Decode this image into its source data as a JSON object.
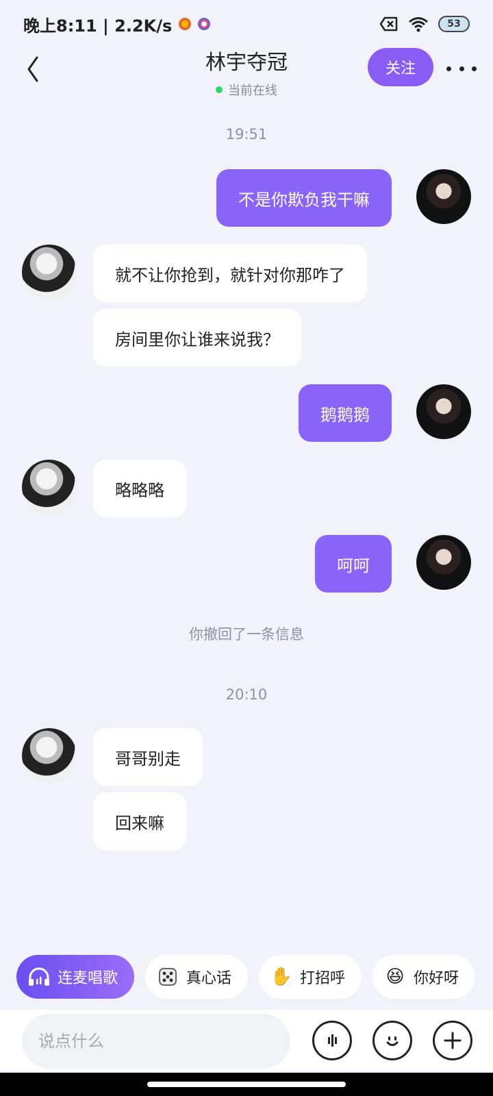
{
  "status_bar": {
    "time_speed": "晚上8:11 | 2.2K/s",
    "battery": "53"
  },
  "header": {
    "title": "林宇夺冠",
    "online_status": "当前在线",
    "follow_label": "关注"
  },
  "chat": {
    "time1": "19:51",
    "msg1": "不是你欺负我干嘛",
    "msg2": "就不让你抢到，就针对你那咋了",
    "msg3": "房间里你让谁来说我？",
    "msg4": "鹅鹅鹅",
    "msg5": "略略略",
    "msg6": "呵呵",
    "recall_notice": "你撤回了一条信息",
    "time2": "20:10",
    "msg7": "哥哥别走",
    "msg8": "回来嘛"
  },
  "quick_replies": [
    {
      "label": "连麦唱歌",
      "icon": "headphone-icon"
    },
    {
      "label": "真心话",
      "icon": "dice-icon"
    },
    {
      "label": "打招呼",
      "icon": "wave-hand-icon"
    },
    {
      "label": "你好呀",
      "icon": "laughing-face-icon"
    }
  ],
  "input": {
    "placeholder": "说点什么"
  },
  "colors": {
    "accent": "#8a64f8",
    "background": "#f2f3fa",
    "online": "#2fd46a"
  }
}
